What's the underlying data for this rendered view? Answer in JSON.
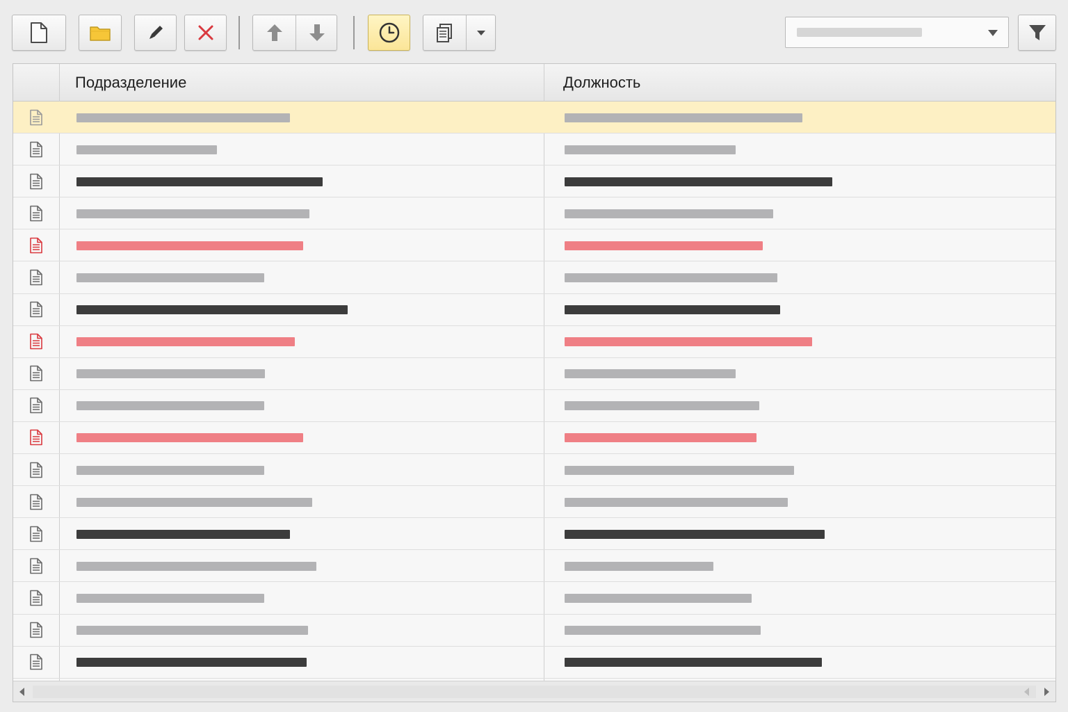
{
  "toolbar": {
    "buttons": [
      {
        "name": "new-document",
        "icon": "document-icon"
      },
      {
        "name": "open-folder",
        "icon": "folder-icon"
      },
      {
        "name": "edit",
        "icon": "pencil-icon"
      },
      {
        "name": "delete",
        "icon": "close-icon"
      },
      {
        "name": "move-up",
        "icon": "arrow-up-icon"
      },
      {
        "name": "move-down",
        "icon": "arrow-down-icon"
      },
      {
        "name": "history",
        "icon": "clock-icon",
        "active": true
      },
      {
        "name": "print",
        "icon": "printer-icon"
      },
      {
        "name": "print-menu",
        "icon": "chevron-down-icon"
      },
      {
        "name": "filter",
        "icon": "filter-icon"
      }
    ],
    "select": {
      "value": ""
    }
  },
  "table": {
    "columns": [
      {
        "label": "Подразделение"
      },
      {
        "label": "Должность"
      }
    ],
    "rows": [
      {
        "status": "gray",
        "selected": true
      },
      {
        "status": "gray"
      },
      {
        "status": "dark"
      },
      {
        "status": "gray"
      },
      {
        "status": "red"
      },
      {
        "status": "gray"
      },
      {
        "status": "dark"
      },
      {
        "status": "red"
      },
      {
        "status": "gray"
      },
      {
        "status": "gray"
      },
      {
        "status": "red"
      },
      {
        "status": "gray"
      },
      {
        "status": "gray"
      },
      {
        "status": "dark"
      },
      {
        "status": "gray"
      },
      {
        "status": "gray"
      },
      {
        "status": "gray"
      },
      {
        "status": "dark"
      }
    ]
  },
  "colors": {
    "selected_row": "#fdf0c4",
    "active_button": "#fbe598",
    "text_gray": "#b3b3b5",
    "text_dark": "#3c3c3c",
    "text_red": "#ef7f85",
    "delete_icon": "#d9393f"
  }
}
